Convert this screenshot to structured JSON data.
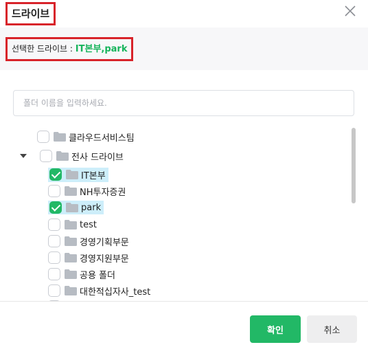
{
  "dialog": {
    "title": "드라이브",
    "selected_label": "선택한 드라이브 : ",
    "selected_value": "IT본부,park"
  },
  "search": {
    "placeholder": "폴더 이름을 입력하세요.",
    "value": ""
  },
  "tree": {
    "items": [
      {
        "label": "클라우드서비스팀",
        "checked": false
      },
      {
        "label": "전사 드라이브",
        "checked": false,
        "expanded": true
      },
      {
        "label": "IT본부",
        "checked": true
      },
      {
        "label": "NH투자증권",
        "checked": false
      },
      {
        "label": "park",
        "checked": true
      },
      {
        "label": "test",
        "checked": false
      },
      {
        "label": "경영기획부문",
        "checked": false
      },
      {
        "label": "경영지원부문",
        "checked": false
      },
      {
        "label": "공용 폴더",
        "checked": false
      },
      {
        "label": "대한적십자사_test",
        "checked": false
      },
      {
        "label": "",
        "checked": false
      }
    ]
  },
  "footer": {
    "confirm_label": "확인",
    "cancel_label": "취소"
  },
  "colors": {
    "accent": "#22b866",
    "highlight_border": "#d8232a",
    "selection_bg": "#cdeefa"
  }
}
